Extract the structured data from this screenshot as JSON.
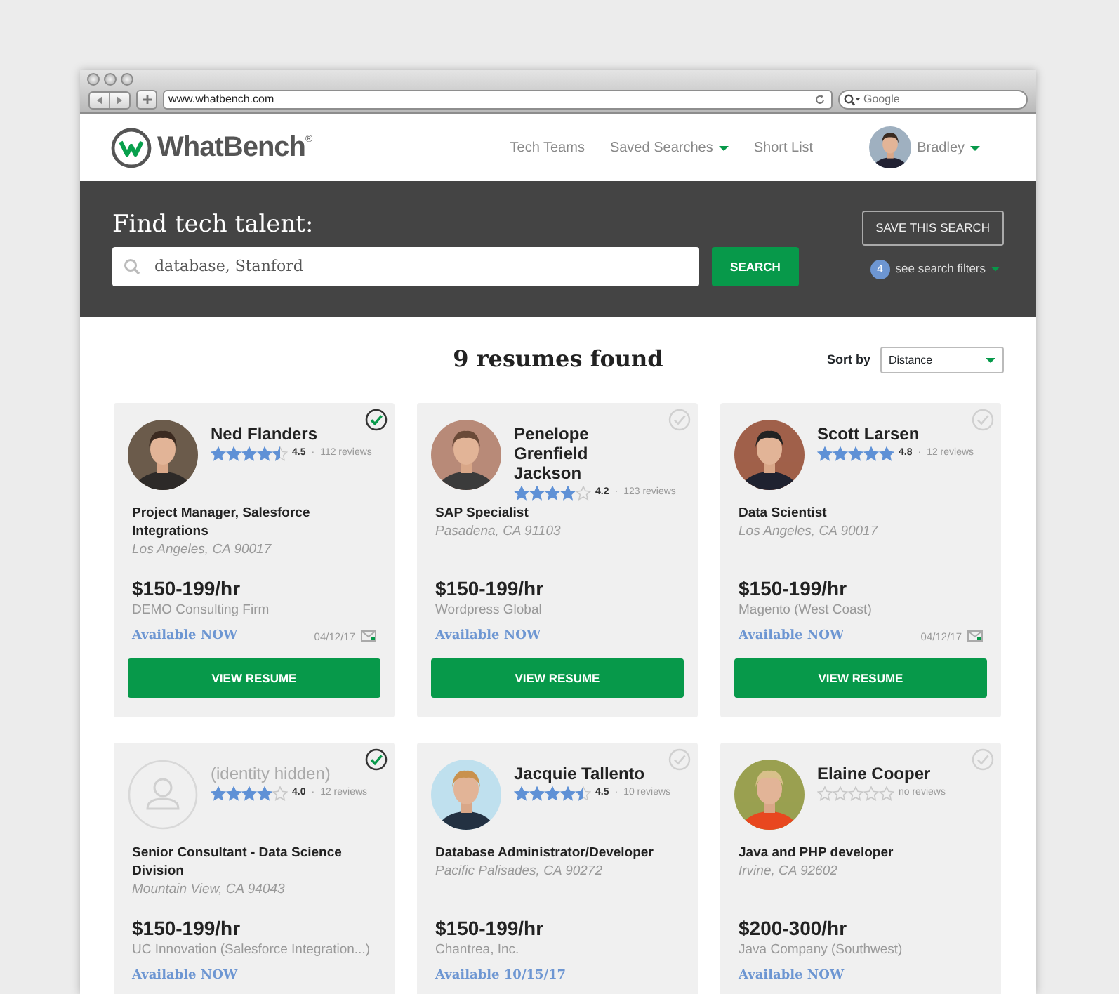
{
  "browser": {
    "url": "www.whatbench.com",
    "search_placeholder": "Google"
  },
  "navbar": {
    "logo": "WhatBench",
    "logo_mark": "®",
    "items": [
      {
        "label": "Tech Teams",
        "dropdown": false
      },
      {
        "label": "Saved Searches",
        "dropdown": true
      },
      {
        "label": "Short List",
        "dropdown": false
      }
    ],
    "user": {
      "name": "Bradley",
      "dropdown": true
    }
  },
  "search": {
    "heading": "Find tech talent:",
    "value": "database, Stanford",
    "button": "SEARCH",
    "save_button": "SAVE THIS SEARCH",
    "filter_count": "4",
    "filters_label": "see search filters"
  },
  "results": {
    "heading": "9 resumes found",
    "sort_label": "Sort by",
    "sort_value": "Distance"
  },
  "candidates": [
    {
      "name": "Ned Flanders",
      "stars": 4.5,
      "rating": "4.5",
      "separator": "·",
      "reviews": "112 reviews",
      "title": "Project Manager, Salesforce Integrations",
      "location": "Los Angeles, CA 90017",
      "rate": "$150-199/hr",
      "company": "DEMO Consulting Firm",
      "availability": "Available NOW",
      "date": "04/12/17",
      "selected": true,
      "button": "VIEW RESUME"
    },
    {
      "name": "Penelope Grenfield Jackson",
      "stars": 4,
      "rating": "4.2",
      "separator": "·",
      "reviews": "123 reviews",
      "title": "SAP Specialist",
      "location": "Pasadena, CA 91103",
      "rate": "$150-199/hr",
      "company": "Wordpress Global",
      "availability": "Available NOW",
      "selected": false,
      "button": "VIEW RESUME"
    },
    {
      "name": "Scott Larsen",
      "stars": 5,
      "rating": "4.8",
      "separator": "·",
      "reviews": "12 reviews",
      "title": "Data Scientist",
      "location": "Los Angeles, CA 90017",
      "rate": "$150-199/hr",
      "company": "Magento (West Coast)",
      "availability": "Available NOW",
      "date": "04/12/17",
      "selected": false,
      "button": "VIEW RESUME"
    },
    {
      "kind": "placeholder",
      "name": "(identity hidden)",
      "stars": 4,
      "rating": "4.0",
      "separator": "·",
      "reviews": "12 reviews",
      "title": "Senior Consultant - Data Science Division",
      "location": "Mountain View, CA 94043",
      "rate": "$150-199/hr",
      "company": "UC Innovation (Salesforce Integration...)",
      "availability": "Available NOW",
      "selected": true
    },
    {
      "name": "Jacquie Tallento",
      "stars": 4.5,
      "rating": "4.5",
      "separator": "·",
      "reviews": "10 reviews",
      "title": "Database Administrator/Developer",
      "location": "Pacific Palisades, CA 90272",
      "rate": "$150-199/hr",
      "company": "Chantrea, Inc.",
      "availability": "Available 10/15/17",
      "selected": false
    },
    {
      "name": "Elaine Cooper",
      "stars": 0,
      "reviews": "no reviews",
      "title": "Java and PHP developer",
      "location": "Irvine, CA 92602",
      "rate": "$200-300/hr",
      "company": "Java Company (Southwest)",
      "availability": "Available NOW",
      "selected": false
    }
  ]
}
